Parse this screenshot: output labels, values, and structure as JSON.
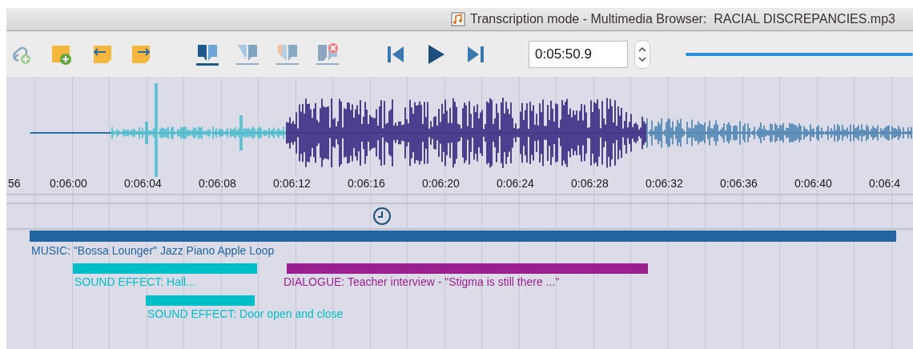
{
  "window": {
    "title": "Transcription mode - Multimedia Browser:  RACIAL DISCREPANCIES.mp3"
  },
  "toolbar": {
    "time_field": {
      "value": "0:05:50.9"
    }
  },
  "ruler": {
    "labels": [
      "56",
      "0:06:00",
      "0:06:04",
      "0:06:08",
      "0:06:12",
      "0:06:16",
      "0:06:20",
      "0:06:24",
      "0:06:28",
      "0:06:32",
      "0:06:36",
      "0:06:40",
      "0:06:4"
    ]
  },
  "segments": [
    {
      "kind": "music",
      "label": "MUSIC: \"Bossa Lounger\" Jazz Piano Apple Loop",
      "color": "#2166a0"
    },
    {
      "kind": "sound_effect",
      "label": "SOUND EFFECT: Hall...",
      "color": "#00bfc8"
    },
    {
      "kind": "dialogue",
      "label": "DIALOGUE: Teacher interview - \"Stigma is still there ...\"",
      "color": "#9b1f8e"
    },
    {
      "kind": "sound_effect",
      "label": "SOUND EFFECT: Door open and close",
      "color": "#00bfc8"
    }
  ]
}
